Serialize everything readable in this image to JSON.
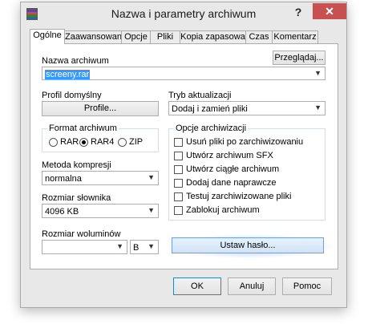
{
  "window": {
    "title": "Nazwa i parametry archiwum",
    "help_label": "?",
    "close_label": "✕"
  },
  "tabs": [
    {
      "label": "Ogólne",
      "active": true
    },
    {
      "label": "Zaawansowane"
    },
    {
      "label": "Opcje"
    },
    {
      "label": "Pliki"
    },
    {
      "label": "Kopia zapasowa"
    },
    {
      "label": "Czas"
    },
    {
      "label": "Komentarz"
    }
  ],
  "archive_name": {
    "label": "Nazwa archiwum",
    "browse_label": "Przeglądaj...",
    "value": "screeny.rar"
  },
  "profile": {
    "label": "Profil domyślny",
    "button_label": "Profile..."
  },
  "update_mode": {
    "label": "Tryb aktualizacji",
    "value": "Dodaj i zamień pliki"
  },
  "format": {
    "label": "Format archiwum",
    "options": [
      "RAR",
      "RAR4",
      "ZIP"
    ],
    "selected": "RAR4"
  },
  "compression": {
    "label": "Metoda kompresji",
    "value": "normalna"
  },
  "dictionary": {
    "label": "Rozmiar słownika",
    "value": "4096 KB"
  },
  "volume": {
    "label": "Rozmiar woluminów",
    "value": "",
    "unit": "B"
  },
  "options": {
    "label": "Opcje archiwizacji",
    "items": [
      "Usuń pliki po zarchiwizowaniu",
      "Utwórz archiwum SFX",
      "Utwórz ciągłe archiwum",
      "Dodaj dane naprawcze",
      "Testuj zarchiwizowane pliki",
      "Zablokuj archiwum"
    ]
  },
  "set_password_label": "Ustaw hasło...",
  "footer": {
    "ok_label": "OK",
    "cancel_label": "Anuluj",
    "help_label": "Pomoc"
  },
  "icons": {
    "app": "winrar-icon",
    "dropdown": "chevron-down-icon"
  }
}
